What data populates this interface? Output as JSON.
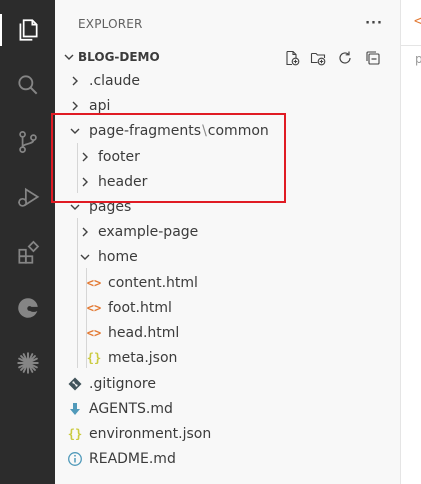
{
  "explorer": {
    "title": "EXPLORER",
    "more_label": "···",
    "section_title": "BLOG-DEMO"
  },
  "tree": [
    {
      "label": "",
      "parts": [
        ".claude"
      ],
      "kind": "folder",
      "expanded": false
    },
    {
      "label": "",
      "parts": [
        "api"
      ],
      "kind": "folder",
      "expanded": false
    },
    {
      "label": "",
      "parts": [
        "page-fragments",
        "common"
      ],
      "kind": "folder",
      "expanded": true
    },
    {
      "parts": [
        "footer"
      ],
      "kind": "folder",
      "expanded": false
    },
    {
      "parts": [
        "header"
      ],
      "kind": "folder",
      "expanded": false
    },
    {
      "parts": [
        "pages"
      ],
      "kind": "folder",
      "expanded": true
    },
    {
      "parts": [
        "example-page"
      ],
      "kind": "folder",
      "expanded": false
    },
    {
      "parts": [
        "home"
      ],
      "kind": "folder",
      "expanded": true
    },
    {
      "parts": [
        "content.html"
      ],
      "kind": "html"
    },
    {
      "parts": [
        "foot.html"
      ],
      "kind": "html"
    },
    {
      "parts": [
        "head.html"
      ],
      "kind": "html"
    },
    {
      "parts": [
        "meta.json"
      ],
      "kind": "json"
    },
    {
      "parts": [
        ".gitignore"
      ],
      "kind": "git"
    },
    {
      "parts": [
        "AGENTS.md"
      ],
      "kind": "markdown"
    },
    {
      "parts": [
        "environment.json"
      ],
      "kind": "json"
    },
    {
      "parts": [
        "README.md"
      ],
      "kind": "info"
    }
  ],
  "labels": {
    "claude": ".claude",
    "api": "api",
    "page_fragments": "page-fragments",
    "path_separator": "\\",
    "common": "common",
    "footer": "footer",
    "header": "header",
    "pages": "pages",
    "example_page": "example-page",
    "home": "home",
    "content_html": "content.html",
    "foot_html": "foot.html",
    "head_html": "head.html",
    "meta_json": "meta.json",
    "gitignore": ".gitignore",
    "agents_md": "AGENTS.md",
    "environment_json": "environment.json",
    "readme_md": "README.md"
  },
  "icon_glyphs": {
    "html": "<>",
    "json": "{}"
  },
  "colors": {
    "activity_bar": "#2c2c2c",
    "sidebar": "#f8f8f8",
    "highlight": "#e01b24",
    "html_icon": "#e37933",
    "json_icon": "#cbcb41",
    "markdown_icon": "#519aba",
    "git_icon": "#41535b"
  }
}
